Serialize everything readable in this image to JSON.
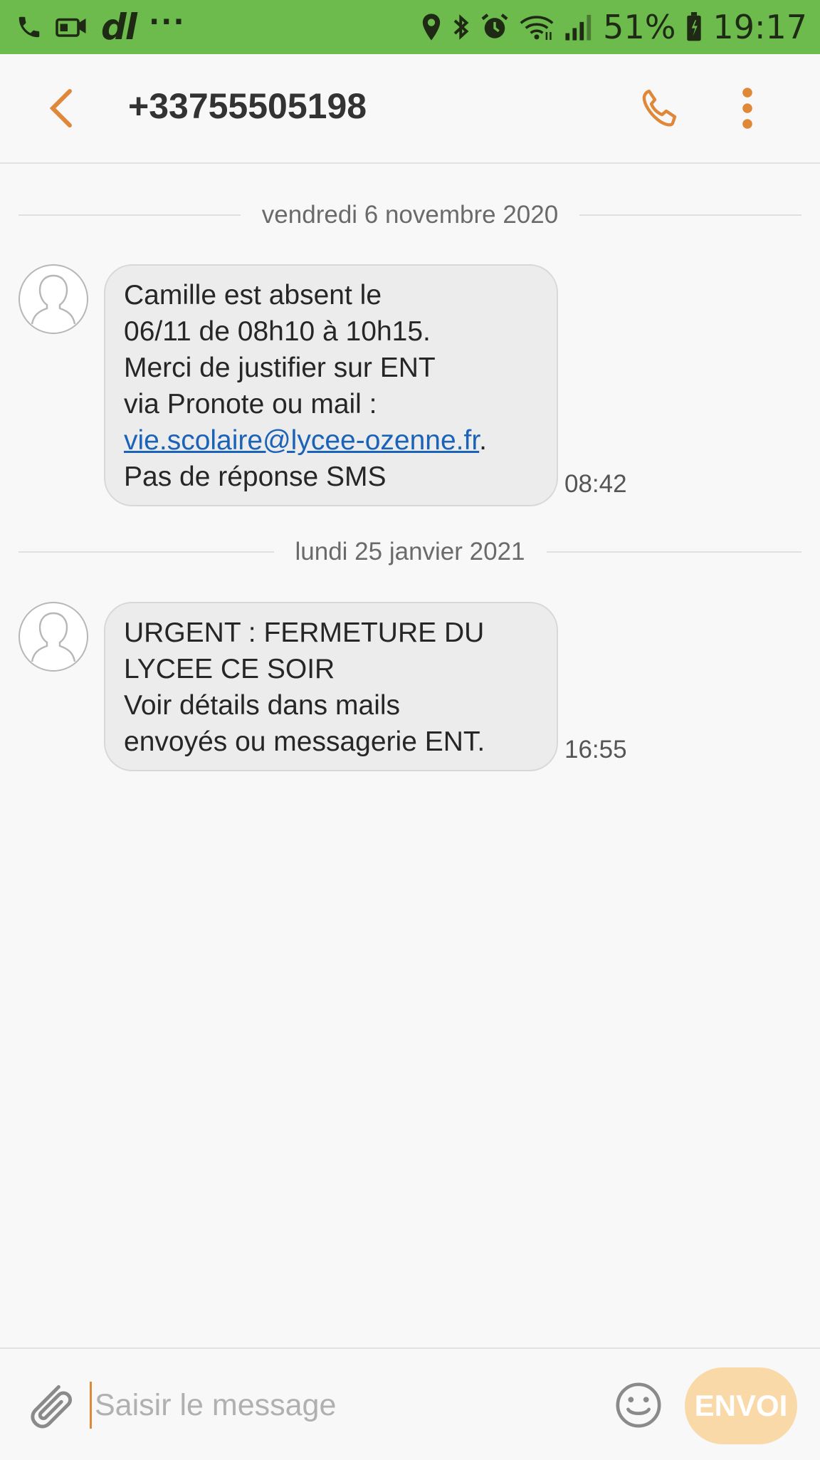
{
  "status_bar": {
    "battery_percent": "51%",
    "time": "19:17",
    "dl_label": "dl",
    "more_label": "···",
    "icons_left": [
      "phone-icon",
      "voicemail-icon",
      "dl-icon",
      "more-dots-icon"
    ],
    "icons_right": [
      "location-icon",
      "bluetooth-icon",
      "alarm-icon",
      "wifi-icon",
      "signal-icon",
      "battery-icon"
    ],
    "background_color": "#6dbb4d"
  },
  "header": {
    "title": "+33755505198",
    "accent_color": "#e0883a",
    "actions": [
      "back-icon",
      "phone-call-icon",
      "more-vertical-icon"
    ]
  },
  "conversation": [
    {
      "date": "vendredi 6 novembre 2020",
      "message": {
        "line1": "Camille est absent le",
        "line2": "06/11 de 08h10 à 10h15.",
        "line3": "Merci de justifier sur ENT",
        "line4": "via Pronote ou mail :",
        "email": "vie.scolaire@lycee-ozenne.fr",
        "email_suffix": ".",
        "line6": "Pas de réponse SMS",
        "time": "08:42"
      }
    },
    {
      "date": "lundi 25 janvier 2021",
      "message": {
        "line1": "URGENT : FERMETURE DU",
        "line2": "LYCEE CE SOIR",
        "line3": "Voir détails dans mails",
        "line4": "envoyés ou messagerie ENT.",
        "time": "16:55"
      }
    }
  ],
  "composer": {
    "placeholder": "Saisir le message",
    "value": "",
    "send_label": "ENVOI",
    "send_color": "#f9d9a8"
  }
}
